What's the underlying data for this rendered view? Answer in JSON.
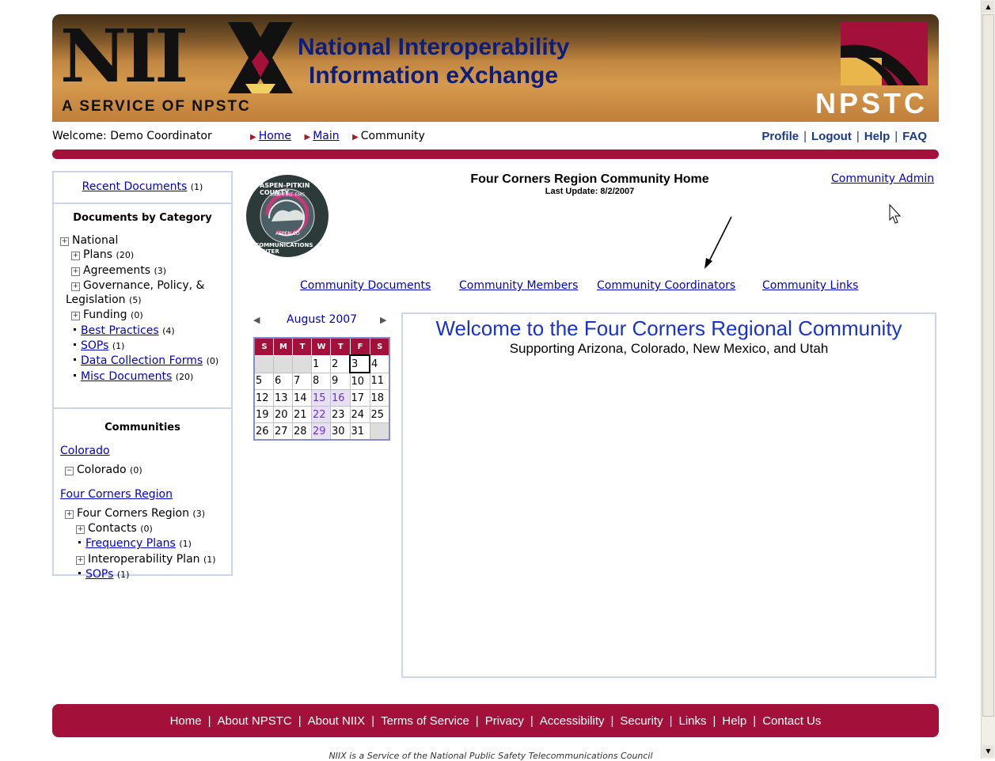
{
  "banner": {
    "logo": "NII",
    "title_line1": "National Interoperability",
    "title_line2": "Information eXchange",
    "service": "A SERVICE OF NPSTC",
    "npstc": "NPSTC",
    "accent": "#a3113b"
  },
  "nav": {
    "welcome": "Welcome: Demo Coordinator",
    "crumbs": [
      "Home",
      "Main",
      "Community"
    ],
    "links": [
      "Profile",
      "Logout",
      "Help",
      "FAQ"
    ]
  },
  "sidebar": {
    "recent_label": "Recent Documents",
    "recent_count": "(1)",
    "category_heading": "Documents by Category",
    "categories": {
      "national": "National",
      "plans": "Plans",
      "plans_count": "(20)",
      "agreements": "Agreements",
      "agreements_count": "(3)",
      "governance": "Governance, Policy, &",
      "governance2": "Legislation",
      "governance_count": "(5)",
      "funding": "Funding",
      "funding_count": "(0)",
      "best": "Best Practices",
      "best_count": "(4)",
      "sops": "SOPs",
      "sops_count": "(1)",
      "data": "Data Collection Forms",
      "data_count": "(0)",
      "misc": "Misc Documents",
      "misc_count": "(20)"
    },
    "communities_heading": "Communities",
    "colorado_link": "Colorado",
    "colorado_node": "Colorado",
    "colorado_count": "(0)",
    "fourcorners_link": "Four Corners Region",
    "fc_node": "Four Corners Region",
    "fc_count": "(3)",
    "contacts": "Contacts",
    "contacts_count": "(0)",
    "freq": "Frequency Plans",
    "freq_count": "(1)",
    "interop": "Interoperability Plan",
    "interop_count": "(1)",
    "fc_sops": "SOPs",
    "fc_sops_count": "(1)"
  },
  "header": {
    "title": "Four Corners Region Community Home",
    "updated": "Last Update: 8/2/2007",
    "admin_link": "Community Admin",
    "logo_text_top": "ASPEN-PITKIN COUNTY",
    "logo_text_bottom": "COMMUNICATIONS CENTER",
    "logo_small": "LAW-FIRE-EMS",
    "logo_city": "ASPEN,CO"
  },
  "tabs": [
    "Community Documents",
    "Community Members",
    "Community Coordinators",
    "Community Links"
  ],
  "calendar": {
    "month": "August 2007",
    "days": [
      "S",
      "M",
      "T",
      "W",
      "T",
      "F",
      "S"
    ],
    "weeks": [
      [
        "",
        "",
        "",
        "1",
        "2",
        "3",
        "4"
      ],
      [
        "5",
        "6",
        "7",
        "8",
        "9",
        "10",
        "11"
      ],
      [
        "12",
        "13",
        "14",
        "15",
        "16",
        "17",
        "18"
      ],
      [
        "19",
        "20",
        "21",
        "22",
        "23",
        "24",
        "25"
      ],
      [
        "26",
        "27",
        "28",
        "29",
        "30",
        "31",
        ""
      ]
    ],
    "highlighted": [
      "15",
      "16",
      "22",
      "29"
    ],
    "today": "3"
  },
  "main": {
    "welcome": "Welcome to the Four Corners Regional Community",
    "subtitle": "Supporting Arizona, Colorado, New Mexico, and Utah"
  },
  "footer": {
    "links": [
      "Home",
      "About NPSTC",
      "About NIIX",
      "Terms of Service",
      "Privacy",
      "Accessibility",
      "Security",
      "Links",
      "Help",
      "Contact Us"
    ],
    "note": "NIIX is a Service of the National Public Safety Telecommunications Council"
  }
}
